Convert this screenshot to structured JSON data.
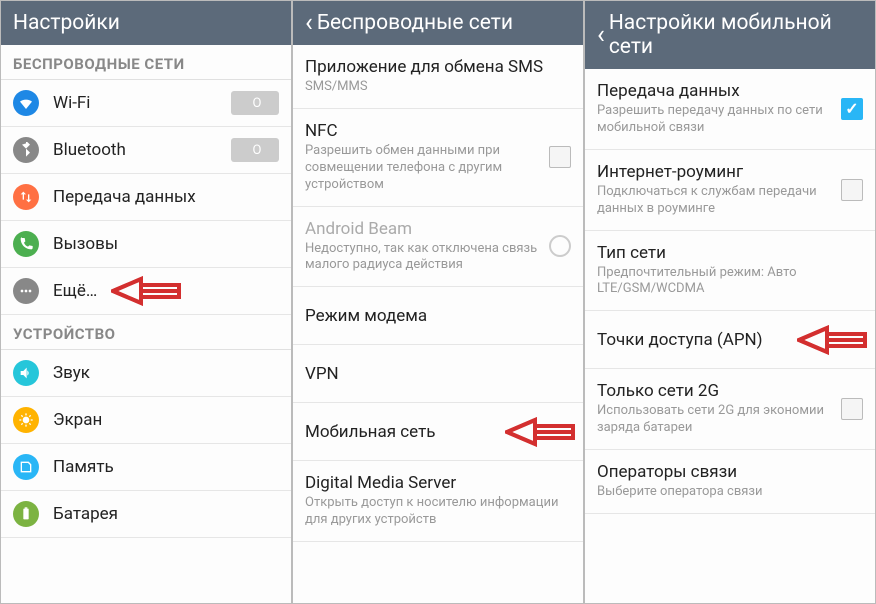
{
  "panel1": {
    "header": "Настройки",
    "sectionA": "БЕСПРОВОДНЫЕ СЕТИ",
    "wifi": "Wi-Fi",
    "wifi_toggle": "O",
    "bluetooth": "Bluetooth",
    "bt_toggle": "O",
    "data": "Передача данных",
    "calls": "Вызовы",
    "more": "Ещё…",
    "sectionB": "УСТРОЙСТВО",
    "sound": "Звук",
    "screen": "Экран",
    "memory": "Память",
    "battery": "Батарея"
  },
  "panel2": {
    "header": "Беспроводные сети",
    "sms": {
      "title": "Приложение для обмена SMS",
      "sub": "SMS/MMS"
    },
    "nfc": {
      "title": "NFC",
      "sub": "Разрешить обмен данными при совмещении телефона с другим устройством"
    },
    "beam": {
      "title": "Android Beam",
      "sub": "Недоступно, так как отключена связь малого радиуса действия"
    },
    "modem": "Режим модема",
    "vpn": "VPN",
    "mobile": "Мобильная сеть",
    "dms": {
      "title": "Digital Media Server",
      "sub": "Открыть доступ к носителю информации для других устройств"
    }
  },
  "panel3": {
    "header": "Настройки мобильной сети",
    "data": {
      "title": "Передача данных",
      "sub": "Разрешить передачу данных по сети мобильной связи"
    },
    "roaming": {
      "title": "Интернет-роуминг",
      "sub": "Подключаться к службам передачи данных в роуминге"
    },
    "nettype": {
      "title": "Тип сети",
      "sub": "Предпочтительный режим: Авто LTE/GSM/WCDMA"
    },
    "apn": "Точки доступа (APN)",
    "only2g": {
      "title": "Только сети 2G",
      "sub": "Использовать сети 2G для экономии заряда батареи"
    },
    "operators": {
      "title": "Операторы связи",
      "sub": "Выберите оператора связи"
    }
  }
}
